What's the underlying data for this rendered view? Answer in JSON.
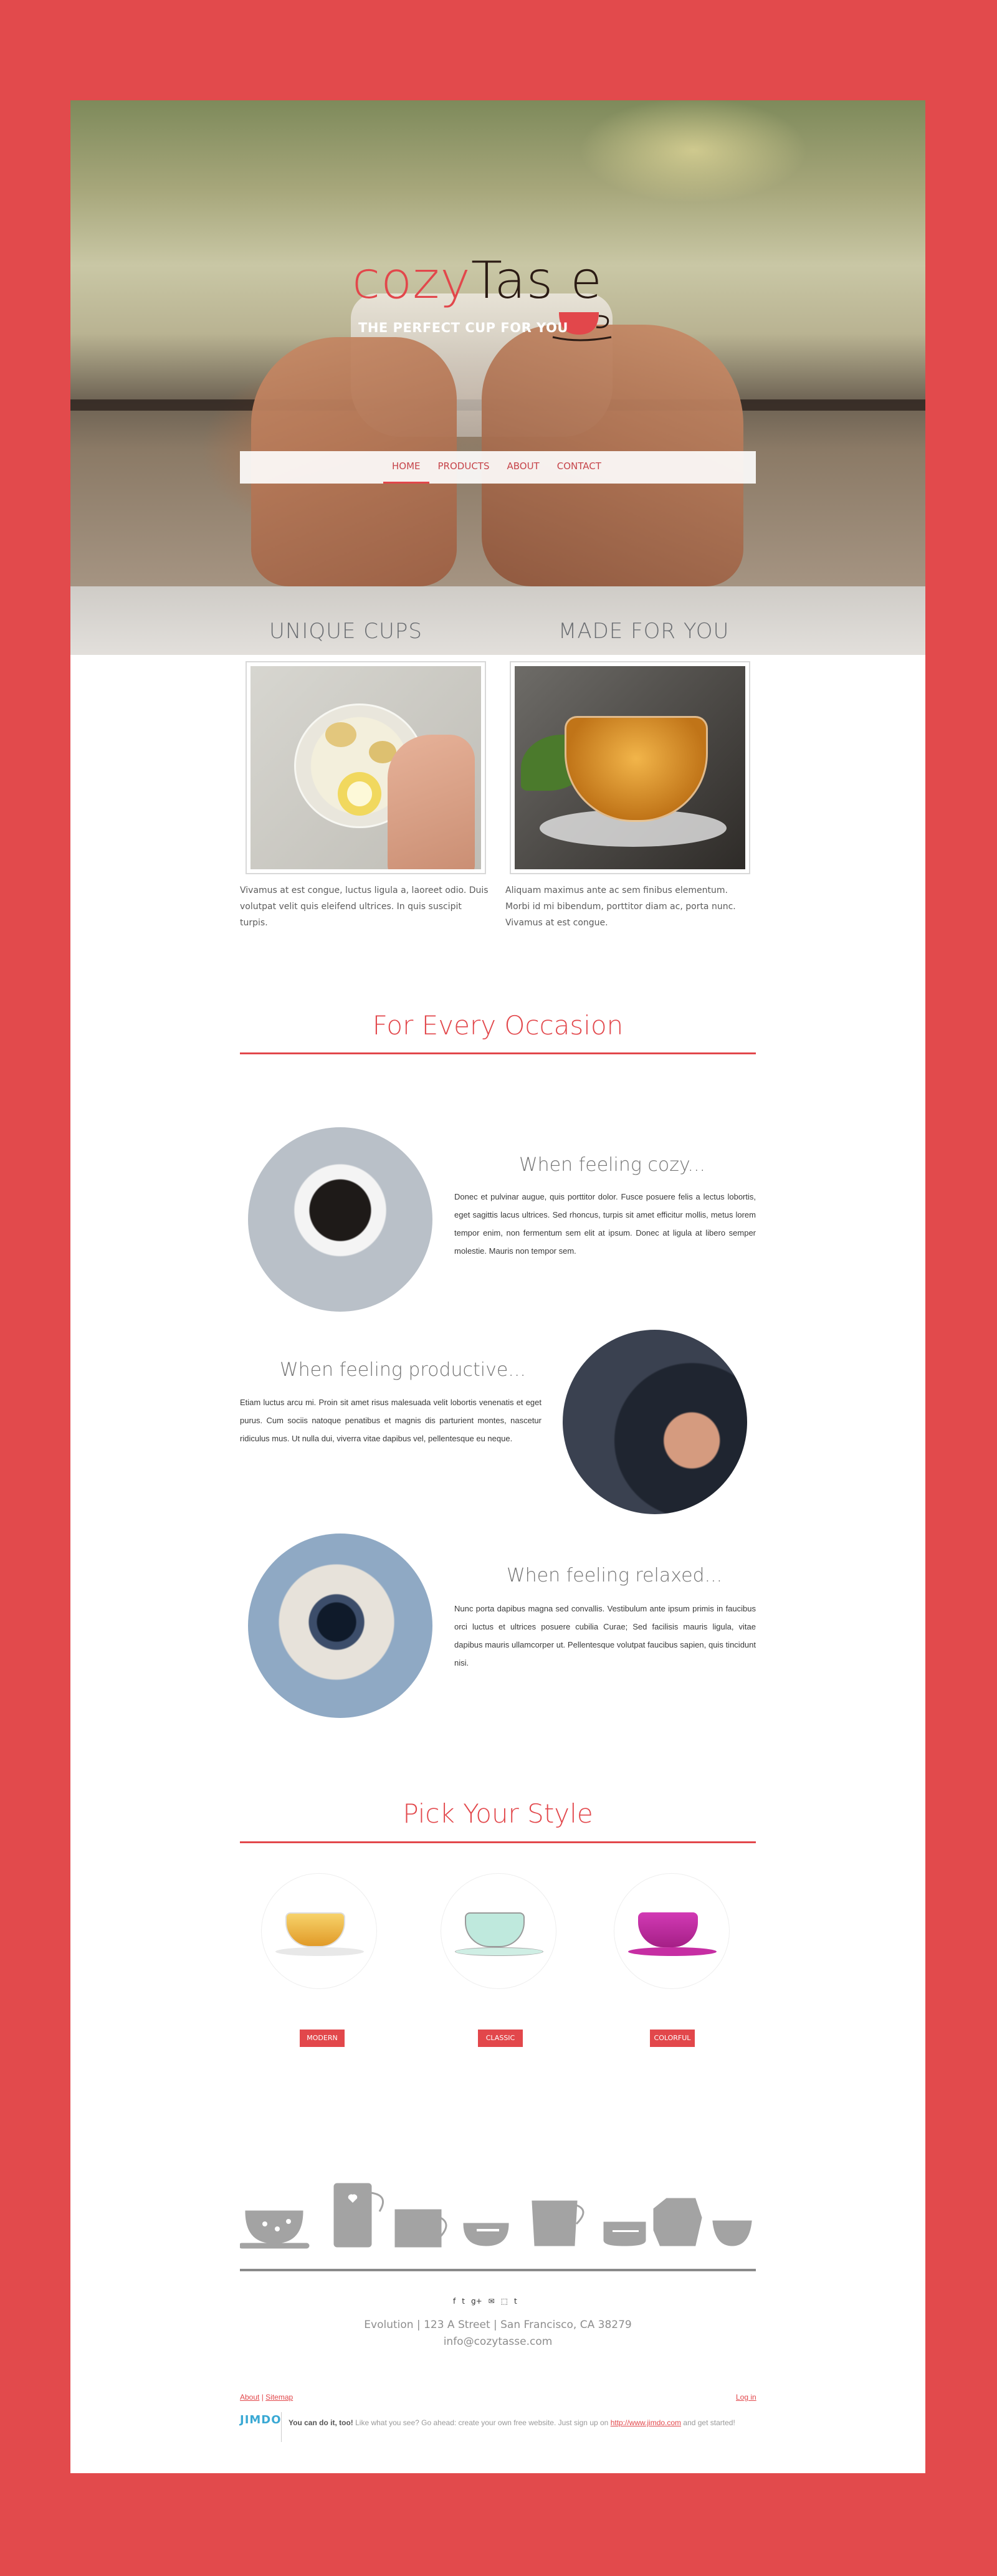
{
  "brand": {
    "name_part1": "cozy",
    "name_part2": "Tas e",
    "tagline": "THE PERFECT CUP FOR YOU"
  },
  "nav": {
    "items": [
      "HOME",
      "PRODUCTS",
      "ABOUT",
      "CONTACT"
    ],
    "active": "HOME"
  },
  "features": {
    "left_title": "UNIQUE CUPS",
    "right_title": "MADE FOR YOU",
    "left_text": "Vivamus at est congue, luctus ligula a, laoreet odio. Duis volutpat velit quis eleifend ultrices. In quis suscipit turpis.",
    "right_text": "Aliquam maximus ante ac sem finibus elementum. Morbi id mi bibendum, porttitor diam ac, porta nunc. Vivamus at est congue."
  },
  "occasion": {
    "title": "For Every Occasion",
    "items": [
      {
        "title": "When feeling cozy...",
        "text": "Donec et pulvinar augue, quis porttitor dolor. Fusce posuere felis a lectus lobortis, eget sagittis lacus ultrices. Sed rhoncus, turpis sit amet efficitur mollis, metus lorem tempor enim, non fermentum sem elit at ipsum. Donec at ligula at libero semper molestie. Mauris non tempor sem."
      },
      {
        "title": "When feeling productive...",
        "text": "Etiam luctus arcu mi. Proin sit amet risus malesuada velit lobortis venenatis et eget purus. Cum sociis natoque penatibus et magnis dis parturient montes, nascetur ridiculus mus. Ut nulla dui, viverra vitae dapibus vel, pellentesque eu neque."
      },
      {
        "title": "When feeling relaxed...",
        "text": "Nunc porta dapibus magna sed convallis. Vestibulum ante ipsum primis in faucibus orci luctus et ultrices posuere cubilia Curae; Sed facilisis mauris ligula, vitae dapibus mauris ullamcorper ut. Pellentesque volutpat faucibus sapien, quis tincidunt nisi."
      }
    ]
  },
  "style": {
    "title": "Pick Your Style",
    "buttons": [
      "MODERN",
      "CLASSIC",
      "COLORFUL"
    ]
  },
  "footer": {
    "social": [
      "f",
      "t",
      "g+",
      "✉",
      "⬚",
      "t"
    ],
    "address": "Evolution | 123 A Street | San Francisco, CA 38279",
    "email": "info@cozytasse.com",
    "links": {
      "about": "About",
      "sitemap": "Sitemap",
      "separator": " | "
    },
    "login": "Log in",
    "jimdo": {
      "logo": "JIMDO",
      "bold": "You can do it, too!",
      "text": " Like what you see? Go ahead: create your own free website. Just sign up on ",
      "link": "http://www.jimdo.com",
      "end": " and get started!"
    }
  },
  "colors": {
    "accent": "#e2474b",
    "outer_bg": "#e24a4c"
  }
}
